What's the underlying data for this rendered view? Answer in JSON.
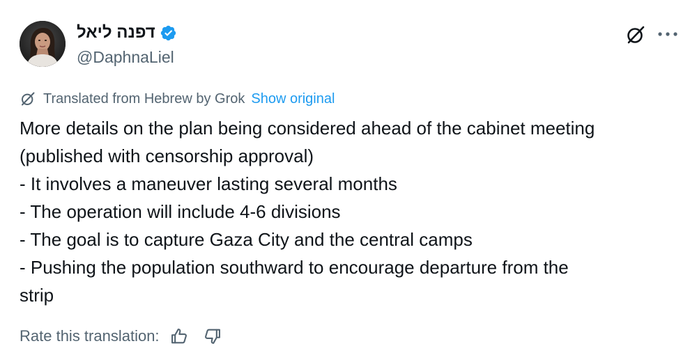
{
  "author": {
    "display_name": "דפנה ליאל",
    "handle": "@DaphnaLiel",
    "verified": true
  },
  "translation": {
    "notice": "Translated from Hebrew by Grok",
    "show_original_label": "Show original"
  },
  "tweet": {
    "lines": [
      "More details on the plan being considered ahead of the cabinet meeting",
      "(published with censorship approval)",
      "- It involves a maneuver lasting several months",
      "- The operation will include 4-6 divisions",
      "- The goal is to capture Gaza City and the central camps",
      "- Pushing the population southward to encourage departure from the",
      "strip"
    ]
  },
  "rating": {
    "label": "Rate this translation:"
  },
  "icons": {
    "verified": "verified-badge-icon",
    "grok": "grok-icon",
    "more": "more-icon",
    "thumbs_up": "thumbs-up-icon",
    "thumbs_down": "thumbs-down-icon"
  },
  "colors": {
    "text_primary": "#0f1419",
    "text_secondary": "#536471",
    "link": "#1d9bf0",
    "verified": "#1d9bf0"
  }
}
